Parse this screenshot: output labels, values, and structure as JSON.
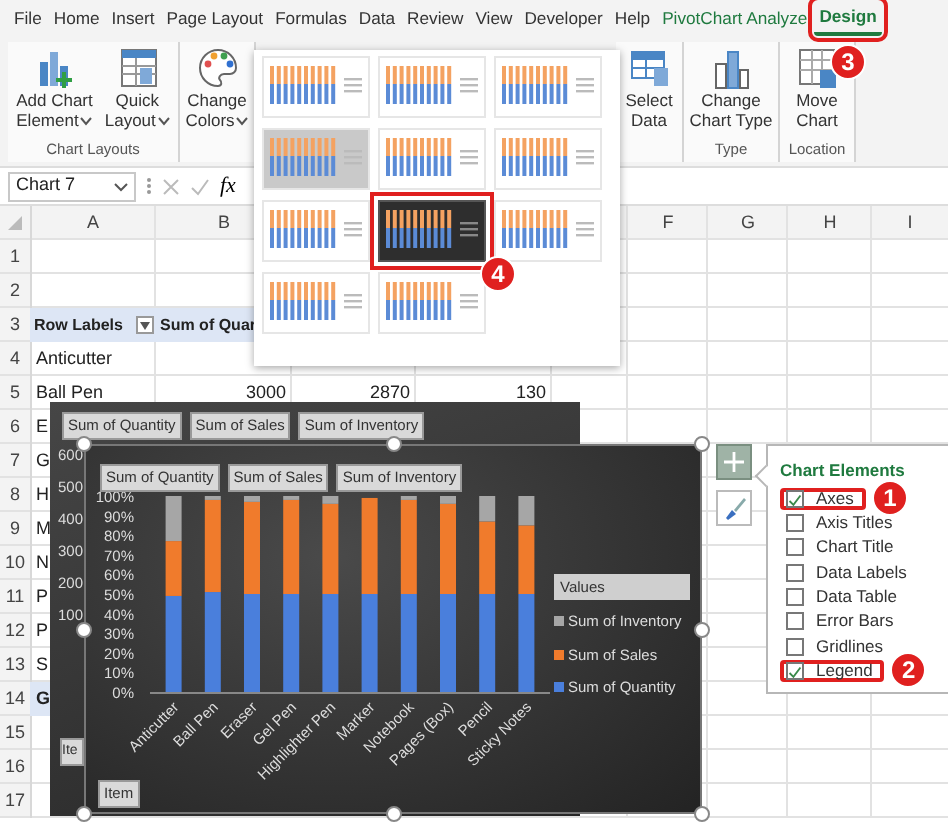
{
  "ribbon_tabs": [
    {
      "label": "File",
      "kind": "standard",
      "selected": false,
      "highlighted": false
    },
    {
      "label": "Home",
      "kind": "standard",
      "selected": false,
      "highlighted": false
    },
    {
      "label": "Insert",
      "kind": "standard",
      "selected": false,
      "highlighted": false
    },
    {
      "label": "Page Layout",
      "kind": "standard",
      "selected": false,
      "highlighted": false
    },
    {
      "label": "Formulas",
      "kind": "standard",
      "selected": false,
      "highlighted": false
    },
    {
      "label": "Data",
      "kind": "standard",
      "selected": false,
      "highlighted": false
    },
    {
      "label": "Review",
      "kind": "standard",
      "selected": false,
      "highlighted": false
    },
    {
      "label": "View",
      "kind": "standard",
      "selected": false,
      "highlighted": false
    },
    {
      "label": "Developer",
      "kind": "standard",
      "selected": false,
      "highlighted": false
    },
    {
      "label": "Help",
      "kind": "standard",
      "selected": false,
      "highlighted": false
    },
    {
      "label": "PivotChart Analyze",
      "kind": "contextual",
      "selected": false,
      "highlighted": false
    },
    {
      "label": "Design",
      "kind": "contextual",
      "selected": true,
      "highlighted": true,
      "callout": "3"
    }
  ],
  "ribbon": {
    "groups": [
      {
        "label": "Chart Layouts",
        "buttons": [
          {
            "lines": [
              "Add Chart",
              "Element"
            ],
            "dropdown": true
          },
          {
            "lines": [
              "Quick",
              "Layout"
            ],
            "dropdown": true
          }
        ]
      },
      {
        "buttons": [
          {
            "lines": [
              "Change",
              "Colors"
            ],
            "dropdown": true
          }
        ]
      },
      {
        "buttons": [
          {
            "lines": [
              "Select",
              "Data"
            ],
            "dropdown": false
          }
        ]
      },
      {
        "label": "Type",
        "buttons": [
          {
            "lines": [
              "Change",
              "Chart Type"
            ],
            "dropdown": false
          }
        ]
      },
      {
        "label": "Location",
        "buttons": [
          {
            "lines": [
              "Move",
              "Chart"
            ],
            "dropdown": false
          }
        ]
      }
    ]
  },
  "chart_styles": [
    {
      "kind": "light",
      "selected": false,
      "highlighted": false
    },
    {
      "kind": "light",
      "selected": false,
      "highlighted": false
    },
    {
      "kind": "light",
      "selected": false,
      "highlighted": false
    },
    {
      "kind": "gray",
      "selected": false,
      "highlighted": false
    },
    {
      "kind": "light",
      "selected": false,
      "highlighted": false
    },
    {
      "kind": "light",
      "selected": false,
      "highlighted": false
    },
    {
      "kind": "light",
      "selected": false,
      "highlighted": false
    },
    {
      "kind": "dark",
      "selected": true,
      "highlighted": true,
      "callout": "4"
    },
    {
      "kind": "light",
      "selected": false,
      "highlighted": false
    },
    {
      "kind": "light",
      "selected": false,
      "highlighted": false
    },
    {
      "kind": "light",
      "selected": false,
      "highlighted": false
    }
  ],
  "formula_bar": {
    "name_box": "Chart 7",
    "function_button": "fx"
  },
  "sheet": {
    "column_headers": [
      "A",
      "B",
      "F",
      "G",
      "H",
      "I"
    ],
    "rows": [
      {
        "number": "1",
        "kind": "blank"
      },
      {
        "number": "2",
        "kind": "blank"
      },
      {
        "number": "3",
        "kind": "header",
        "cells": [
          "Row Labels",
          "Sum of Quar"
        ]
      },
      {
        "number": "4",
        "kind": "item",
        "cells": [
          "Anticutter"
        ]
      },
      {
        "number": "5",
        "kind": "item",
        "cells": [
          "Ball Pen",
          "3000",
          "2870",
          "130"
        ]
      },
      {
        "number": "6",
        "kind": "item",
        "cells": [
          "E"
        ]
      },
      {
        "number": "7",
        "kind": "item",
        "cells": [
          "G"
        ]
      },
      {
        "number": "8",
        "kind": "item",
        "cells": [
          "H"
        ]
      },
      {
        "number": "9",
        "kind": "item",
        "cells": [
          "M"
        ]
      },
      {
        "number": "10",
        "kind": "item",
        "cells": [
          "N"
        ]
      },
      {
        "number": "11",
        "kind": "item",
        "cells": [
          "P"
        ]
      },
      {
        "number": "12",
        "kind": "item",
        "cells": [
          "P"
        ]
      },
      {
        "number": "13",
        "kind": "item",
        "cells": [
          "S"
        ]
      },
      {
        "number": "14",
        "kind": "total",
        "cells": [
          "G"
        ]
      },
      {
        "number": "15",
        "kind": "blank"
      },
      {
        "number": "16",
        "kind": "blank"
      },
      {
        "number": "17",
        "kind": "blank"
      }
    ]
  },
  "back_chart": {
    "field_buttons": [
      "Sum of Quantity",
      "Sum of Sales",
      "Sum of Inventory"
    ],
    "axis_labels": [
      "600",
      "500",
      "400",
      "300",
      "200",
      "100"
    ],
    "axis_field_button": "Ite"
  },
  "front_chart": {
    "field_buttons": [
      "Sum of Quantity",
      "Sum of Sales",
      "Sum of Inventory"
    ],
    "axis_field_button": "Item",
    "legend_title": "Values",
    "chart_data": {
      "type": "bar",
      "stacked": true,
      "orientation": "vertical",
      "categories": [
        "Anticutter",
        "Ball Pen",
        "Eraser",
        "Gel Pen",
        "Highlighter Pen",
        "Marker",
        "Notebook",
        "Pages (Box)",
        "Pencil",
        "Sticky Notes"
      ],
      "series": [
        {
          "name": "Sum of Quantity",
          "color": "#4a7fdc",
          "values": [
            49,
            51,
            50,
            50,
            50,
            50,
            50,
            50,
            50,
            50
          ]
        },
        {
          "name": "Sum of Sales",
          "color": "#f07b2c",
          "values": [
            28,
            47,
            47,
            48,
            46,
            49,
            48,
            46,
            37,
            35
          ]
        },
        {
          "name": "Sum of Inventory",
          "color": "#a6a6a6",
          "values": [
            23,
            2,
            3,
            2,
            4,
            null,
            2,
            4,
            13,
            15
          ]
        }
      ],
      "ylim": [
        0,
        100
      ],
      "yticks": [
        {
          "value": 0,
          "label": "0%"
        },
        {
          "value": 10,
          "label": "10%"
        },
        {
          "value": 20,
          "label": "20%"
        },
        {
          "value": 30,
          "label": "30%"
        },
        {
          "value": 40,
          "label": "40%"
        },
        {
          "value": 50,
          "label": "50%"
        },
        {
          "value": 60,
          "label": "60%"
        },
        {
          "value": 70,
          "label": "70%"
        },
        {
          "value": 80,
          "label": "80%"
        },
        {
          "value": 90,
          "label": "90%"
        },
        {
          "value": 100,
          "label": "100%"
        }
      ]
    }
  },
  "chart_tools": [
    {
      "selected": true
    },
    {
      "selected": false
    }
  ],
  "chart_elements": {
    "title": "Chart Elements",
    "items": [
      {
        "label": "Axes",
        "checked": true,
        "highlighted": true,
        "callout": "1"
      },
      {
        "label": "Axis Titles",
        "checked": false,
        "highlighted": false
      },
      {
        "label": "Chart Title",
        "checked": false,
        "highlighted": false
      },
      {
        "label": "Data Labels",
        "checked": false,
        "highlighted": false
      },
      {
        "label": "Data Table",
        "checked": false,
        "highlighted": false
      },
      {
        "label": "Error Bars",
        "checked": false,
        "highlighted": false
      },
      {
        "label": "Gridlines",
        "checked": false,
        "highlighted": false
      },
      {
        "label": "Legend",
        "checked": true,
        "highlighted": true,
        "callout": "2"
      }
    ]
  }
}
